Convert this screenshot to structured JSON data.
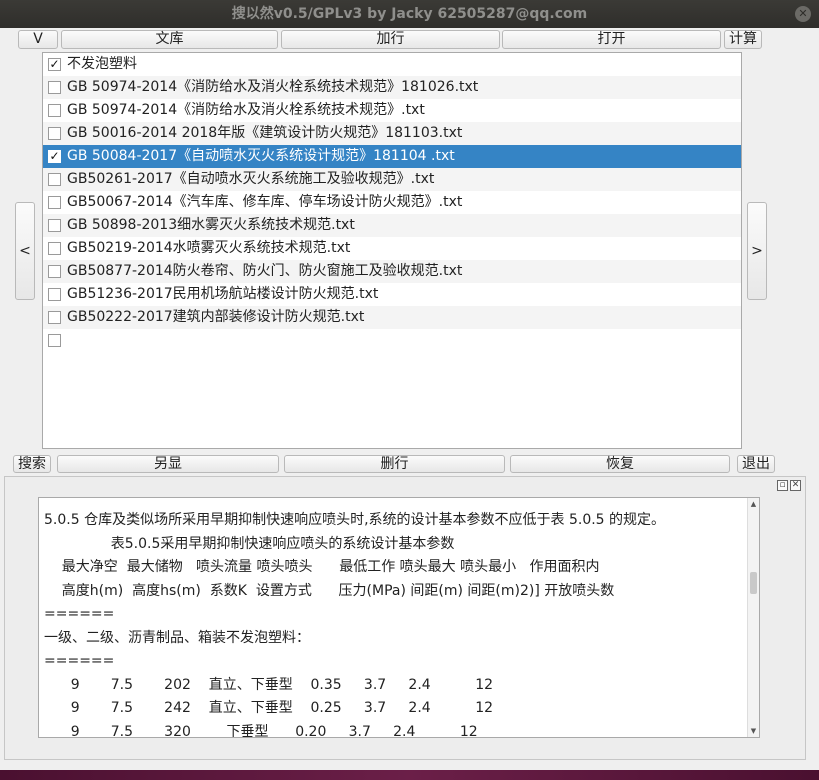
{
  "window": {
    "title": "搜以然v0.5/GPLv3 by Jacky 62505287@qq.com",
    "close_glyph": "✕"
  },
  "toolbar": {
    "v": "V",
    "library": "文库",
    "add_row": "加行",
    "open": "打开",
    "calc": "计算"
  },
  "nav": {
    "prev": "<",
    "next": ">"
  },
  "file_list": [
    {
      "label": "不发泡塑料",
      "checked": true,
      "selected": false
    },
    {
      "label": "GB 50974-2014《消防给水及消火栓系统技术规范》181026.txt",
      "checked": false,
      "selected": false
    },
    {
      "label": "GB 50974-2014《消防给水及消火栓系统技术规范》.txt",
      "checked": false,
      "selected": false
    },
    {
      "label": "GB 50016-2014 2018年版《建筑设计防火规范》181103.txt",
      "checked": false,
      "selected": false
    },
    {
      "label": "GB 50084-2017《自动喷水灭火系统设计规范》181104 .txt",
      "checked": true,
      "selected": true
    },
    {
      "label": "GB50261-2017《自动喷水灭火系统施工及验收规范》.txt",
      "checked": false,
      "selected": false
    },
    {
      "label": "GB50067-2014《汽车库、修车库、停车场设计防火规范》.txt",
      "checked": false,
      "selected": false
    },
    {
      "label": "GB 50898-2013细水雾灭火系统技术规范.txt",
      "checked": false,
      "selected": false
    },
    {
      "label": "GB50219-2014水喷雾灭火系统技术规范.txt",
      "checked": false,
      "selected": false
    },
    {
      "label": "GB50877-2014防火卷帘、防火门、防火窗施工及验收规范.txt",
      "checked": false,
      "selected": false
    },
    {
      "label": "GB51236-2017民用机场航站楼设计防火规范.txt",
      "checked": false,
      "selected": false
    },
    {
      "label": "GB50222-2017建筑内部装修设计防火规范.txt",
      "checked": false,
      "selected": false
    },
    {
      "label": "",
      "checked": false,
      "selected": false
    }
  ],
  "actions": {
    "search": "搜索",
    "other_view": "另显",
    "delete_row": "删行",
    "restore": "恢复",
    "exit": "退出"
  },
  "dock_icons": [
    "restore-icon",
    "close-icon"
  ],
  "result_text": [
    "5.0.5 仓库及类似场所采用早期抑制快速响应喷头时,系统的设计基本参数不应低于表 5.0.5 的规定。",
    "               表5.0.5采用早期抑制快速响应喷头的系统设计基本参数",
    "    最大净空  最大储物   喷头流量 喷头喷头      最低工作 喷头最大 喷头最小   作用面积内",
    "    高度h(m)  高度hs(m)  系数K  设置方式      压力(MPa) 间距(m) 间距(m)2)] 开放喷头数",
    "======",
    "一级、二级、沥青制品、箱装不发泡塑料：",
    "======",
    "      9       7.5       202    直立、下垂型    0.35     3.7     2.4          12",
    "      9       7.5       242    直立、下垂型    0.25     3.7     2.4          12",
    "      9       7.5       320        下垂型      0.20     3.7     2.4          12"
  ]
}
